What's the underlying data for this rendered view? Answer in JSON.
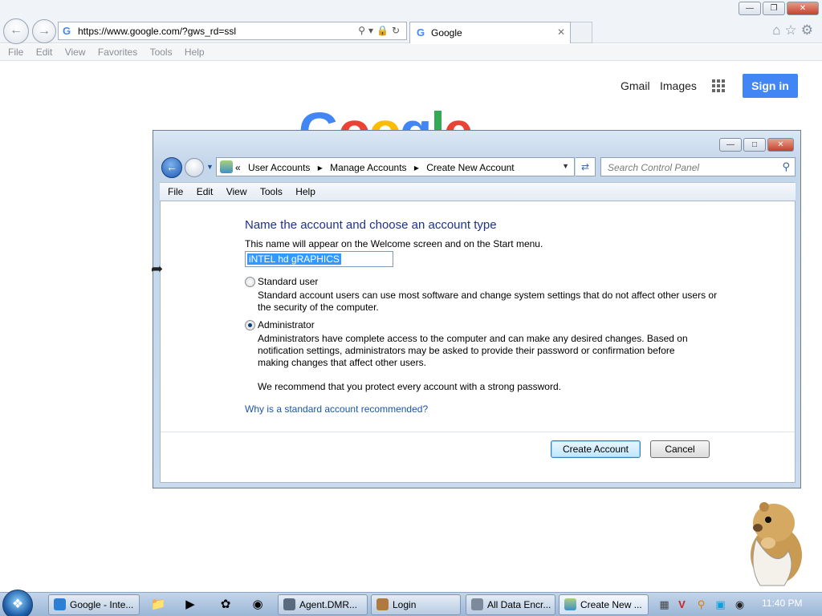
{
  "browser": {
    "address": "https://www.google.com/?gws_rd=ssl",
    "tab_title": "Google",
    "menu": [
      "File",
      "Edit",
      "View",
      "Favorites",
      "Tools",
      "Help"
    ]
  },
  "google": {
    "gmail": "Gmail",
    "images": "Images",
    "signin": "Sign in",
    "logo_colors": [
      "#4285f4",
      "#ea4335",
      "#fbbc05",
      "#4285f4",
      "#34a853",
      "#ea4335"
    ]
  },
  "dialog": {
    "breadcrumbs": [
      "User Accounts",
      "Manage Accounts",
      "Create New Account"
    ],
    "search_placeholder": "Search Control Panel",
    "menu": [
      "File",
      "Edit",
      "View",
      "Tools",
      "Help"
    ],
    "heading": "Name the account and choose an account type",
    "subheading": "This name will appear on the Welcome screen and on the Start menu.",
    "account_name": "iNTEL hd gRAPHICS",
    "standard": {
      "label": "Standard user",
      "desc_1": "Standard account users can use most software and change system settings that do not affect other users or",
      "desc_2": "the security of the computer.",
      "selected": false
    },
    "admin": {
      "label": "Administrator",
      "desc_1": "Administrators have complete access to the computer and can make any desired changes. Based on",
      "desc_2": "notification settings, administrators may be asked to provide their password or confirmation before",
      "desc_3": "making changes that affect other users.",
      "desc_4": "We recommend that you protect every account with a strong password.",
      "selected": true
    },
    "link": "Why is a standard account recommended?",
    "create_button": "Create Account",
    "cancel_button": "Cancel"
  },
  "taskbar": {
    "items": [
      "Google - Inte...",
      "Agent.DMR...",
      "Login",
      "All Data Encr...",
      "Create New ..."
    ],
    "clock": "11:40 PM"
  }
}
